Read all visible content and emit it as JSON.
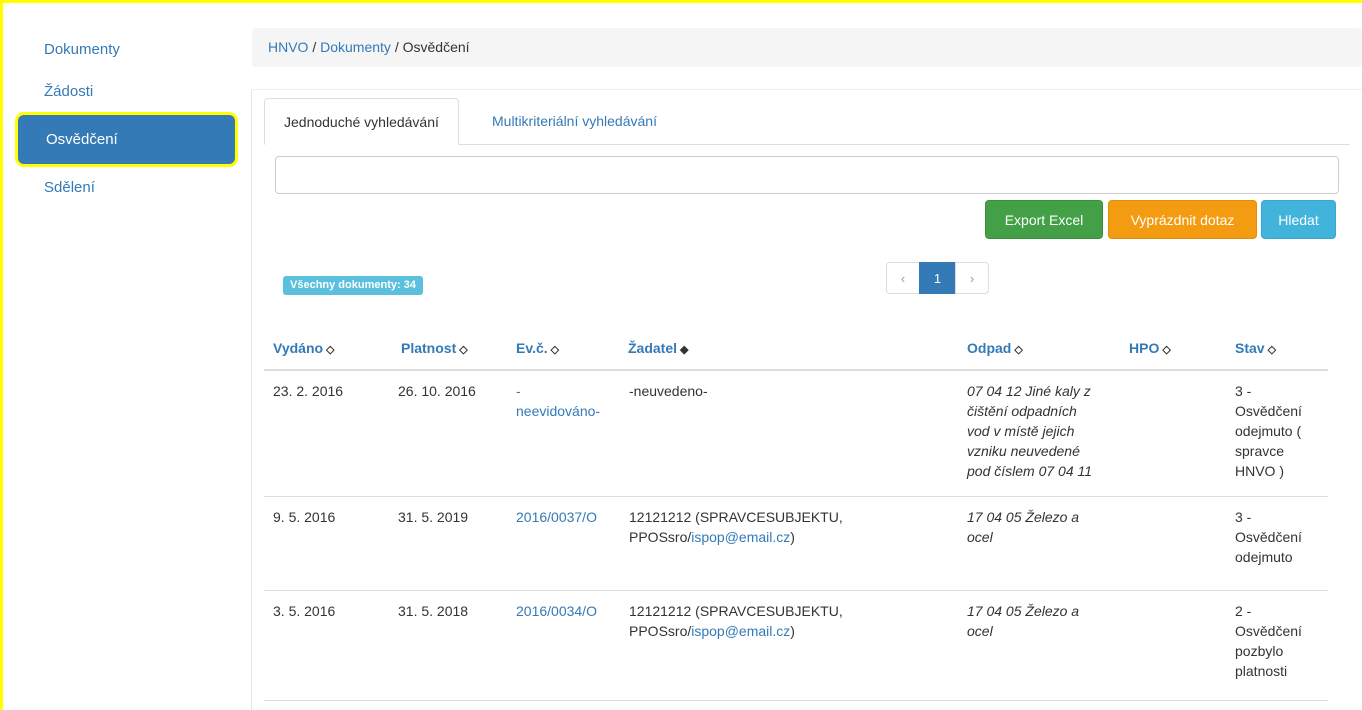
{
  "sidebar": {
    "items": [
      {
        "label": "Dokumenty"
      },
      {
        "label": "Žádosti"
      },
      {
        "label": "Osvědčení"
      },
      {
        "label": "Sdělení"
      }
    ]
  },
  "breadcrumb": {
    "root": "HNVO",
    "sep1": " / ",
    "section": "Dokumenty",
    "sep2": " / ",
    "current": "Osvědčení"
  },
  "tabs": [
    {
      "label": "Jednoduché vyhledávání",
      "active": true
    },
    {
      "label": "Multikriteriální vyhledávání",
      "active": false
    }
  ],
  "search": {
    "value": "",
    "placeholder": ""
  },
  "buttons": {
    "export": "Export Excel",
    "clear": "Vyprázdnit dotaz",
    "search": "Hledat"
  },
  "colors": {
    "primary": "#337ab7",
    "success": "#43a047",
    "warning": "#f39c12",
    "info": "#42b3db",
    "highlight": "#ffff00"
  },
  "badge": "Všechny dokumenty: 34",
  "pagination": {
    "prev": "‹",
    "current": "1",
    "next": "›"
  },
  "table": {
    "headers": [
      {
        "label": "Vydáno",
        "sort": "◇"
      },
      {
        "label": "Platnost",
        "sort": "◇"
      },
      {
        "label": "Ev.č.",
        "sort": "◇"
      },
      {
        "label": "Žadatel",
        "sort": "◆"
      },
      {
        "label": "Odpad",
        "sort": "◇"
      },
      {
        "label": "HPO",
        "sort": "◇"
      },
      {
        "label": "Stav",
        "sort": "◇"
      }
    ],
    "rows": [
      {
        "vydano": "23. 2. 2016",
        "platnost": "26. 10. 2016",
        "ev": [
          "-",
          "neevidováno-"
        ],
        "zadatel": [
          "-neuvedeno-"
        ],
        "zadatel_email": "",
        "odpad": [
          "07 04 12 Jiné kaly z",
          "čištění odpadních",
          "vod v místě jejich",
          "vzniku neuvedené",
          "pod číslem 07 04 11"
        ],
        "stav": [
          "3 -",
          "Osvědčení",
          "odejmuto (",
          "spravce",
          "HNVO )"
        ]
      },
      {
        "vydano": "9. 5. 2016",
        "platnost": "31. 5. 2019",
        "ev": [
          "2016/0037/O"
        ],
        "zadatel": [
          "12121212 (SPRAVCESUBJEKTU,",
          "PPOSsro/"
        ],
        "zadatel_email": "ispop@email.cz",
        "odpad": [
          "17 04 05 Železo a",
          "ocel"
        ],
        "stav": [
          "3 -",
          "Osvědčení",
          "odejmuto"
        ]
      },
      {
        "vydano": "3. 5. 2016",
        "platnost": "31. 5. 2018",
        "ev": [
          "2016/0034/O"
        ],
        "zadatel": [
          "12121212 (SPRAVCESUBJEKTU,",
          "PPOSsro/"
        ],
        "zadatel_email": "ispop@email.cz",
        "odpad": [
          "17 04 05 Železo a",
          "ocel"
        ],
        "stav": [
          "2 -",
          "Osvědčení",
          "pozbylo",
          "platnosti"
        ]
      }
    ]
  }
}
